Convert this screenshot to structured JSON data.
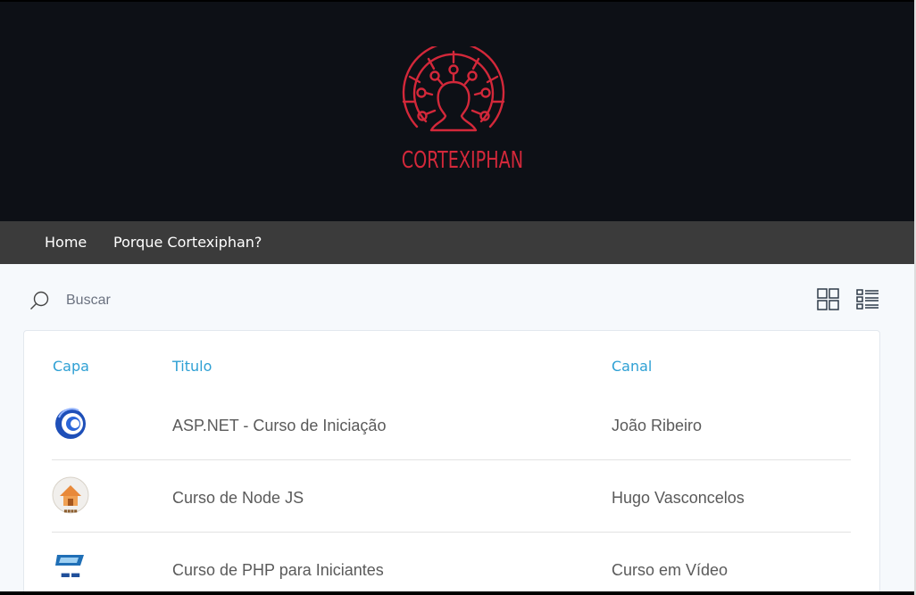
{
  "brand": {
    "name": "CORTEXIPHAN",
    "color": "#d3283a",
    "logo_icon": "circuit-head-icon"
  },
  "nav": {
    "items": [
      {
        "label": "Home"
      },
      {
        "label": "Porque Cortexiphan?"
      }
    ]
  },
  "search": {
    "placeholder": "Buscar",
    "value": ""
  },
  "view_toggle": {
    "grid_icon": "grid-view-icon",
    "list_icon": "list-view-icon"
  },
  "table": {
    "headers": {
      "cover": "Capa",
      "title": "Titulo",
      "channel": "Canal"
    },
    "rows": [
      {
        "title": "ASP.NET - Curso de Iniciação",
        "channel": "João Ribeiro",
        "cover_icon": "swirl-logo-icon"
      },
      {
        "title": "Curso de Node JS",
        "channel": "Hugo Vasconcelos",
        "cover_icon": "house-logo-icon"
      },
      {
        "title": "Curso de PHP para Iniciantes",
        "channel": "Curso em Vídeo",
        "cover_icon": "video-logo-icon"
      }
    ]
  },
  "colors": {
    "banner_bg": "#0d1016",
    "nav_bg": "#3b3b3b",
    "header_accent": "#2ea0d4"
  }
}
